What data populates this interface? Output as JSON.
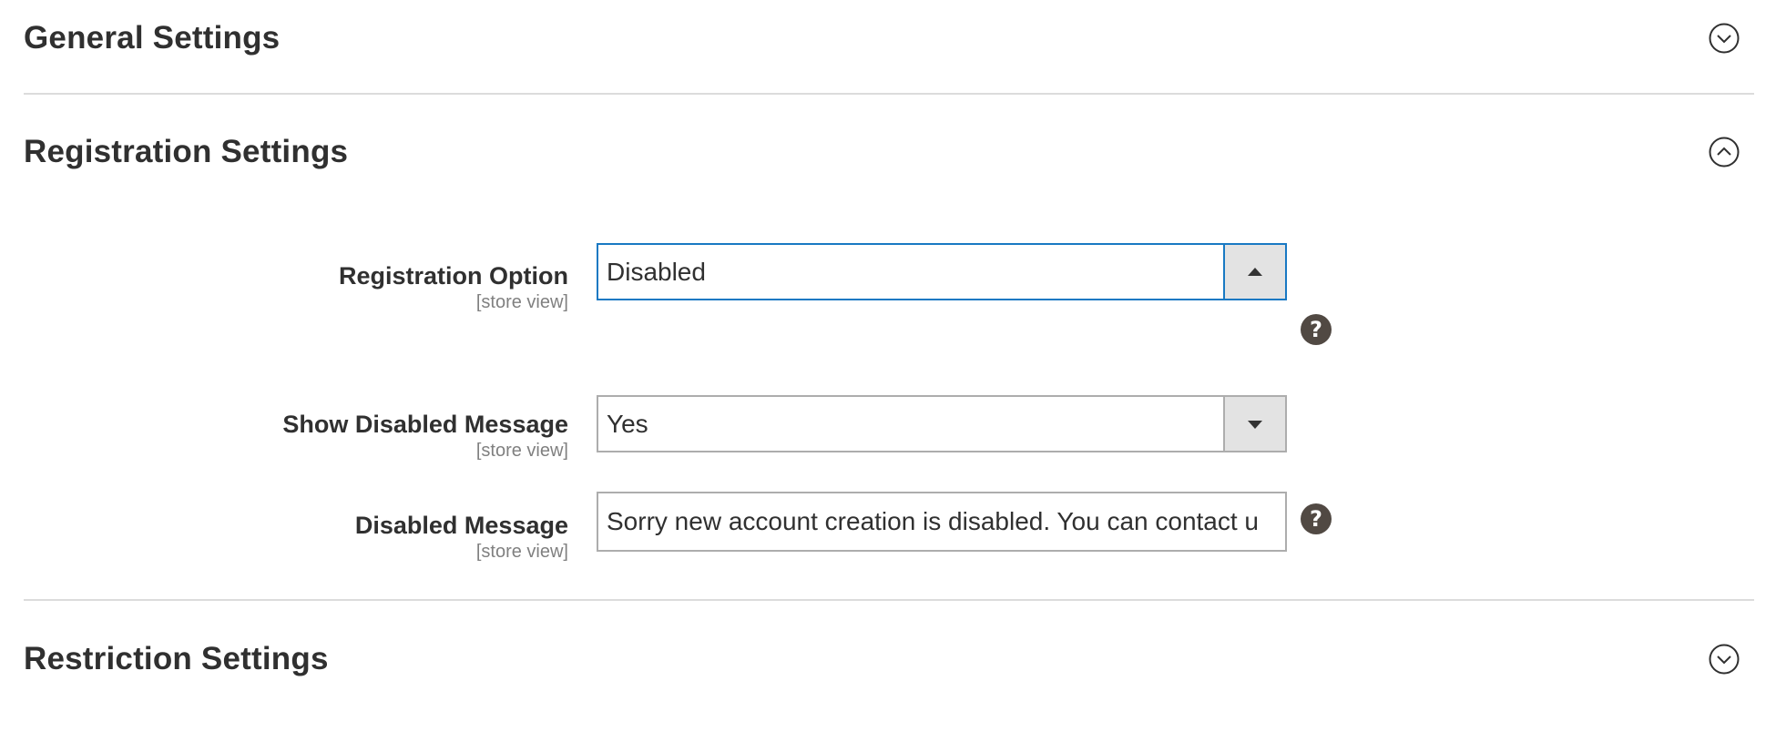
{
  "sections": {
    "general": {
      "title": "General Settings",
      "state_icon": "chevron-down-icon"
    },
    "registration": {
      "title": "Registration Settings",
      "state_icon": "chevron-up-icon"
    },
    "restriction": {
      "title": "Restriction Settings",
      "state_icon": "chevron-down-icon"
    }
  },
  "fields": {
    "registration_option": {
      "label": "Registration Option",
      "scope": "[store view]",
      "value": "Disabled"
    },
    "show_disabled_message": {
      "label": "Show Disabled Message",
      "scope": "[store view]",
      "value": "Yes"
    },
    "disabled_message": {
      "label": "Disabled Message",
      "scope": "[store view]",
      "value": "Sorry new account creation is disabled. You can contact u"
    }
  },
  "help_icon_glyph": "?",
  "colors": {
    "focus_border": "#1979c3",
    "help_icon_bg": "#514943",
    "divider": "#dcdcdc",
    "text": "#303030"
  }
}
